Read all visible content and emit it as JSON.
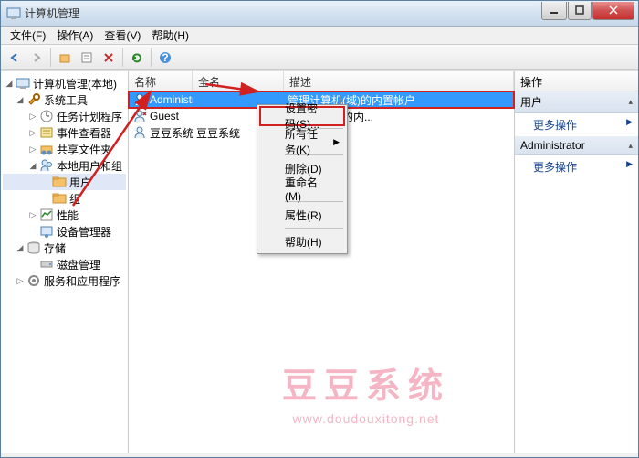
{
  "window": {
    "title": "计算机管理"
  },
  "menubar": {
    "file": "文件(F)",
    "action": "操作(A)",
    "view": "查看(V)",
    "help": "帮助(H)"
  },
  "tree": {
    "root": "计算机管理(本地)",
    "sys_tools": "系统工具",
    "task_sched": "任务计划程序",
    "event_viewer": "事件查看器",
    "shared_folders": "共享文件夹",
    "local_users": "本地用户和组",
    "users": "用户",
    "groups": "组",
    "perf": "性能",
    "dev_mgr": "设备管理器",
    "storage": "存储",
    "disk_mgmt": "磁盘管理",
    "services": "服务和应用程序"
  },
  "list": {
    "col_name": "名称",
    "col_fullname": "全名",
    "col_desc": "描述",
    "rows": [
      {
        "name": "Administrat...",
        "fullname": "",
        "desc": "管理计算机(域)的内置帐户"
      },
      {
        "name": "Guest",
        "fullname": "",
        "desc": "机或访问域的内..."
      },
      {
        "name": "豆豆系统",
        "fullname": "豆豆系统",
        "desc": ""
      }
    ]
  },
  "context_menu": {
    "set_password": "设置密码(S)...",
    "all_tasks": "所有任务(K)",
    "delete": "删除(D)",
    "rename": "重命名(M)",
    "properties": "属性(R)",
    "help": "帮助(H)"
  },
  "actions": {
    "header": "操作",
    "section_user": "用户",
    "more_ops": "更多操作",
    "section_admin": "Administrator",
    "more_ops2": "更多操作"
  },
  "watermark": {
    "text": "豆豆系统",
    "url": "www.doudouxitong.net"
  }
}
